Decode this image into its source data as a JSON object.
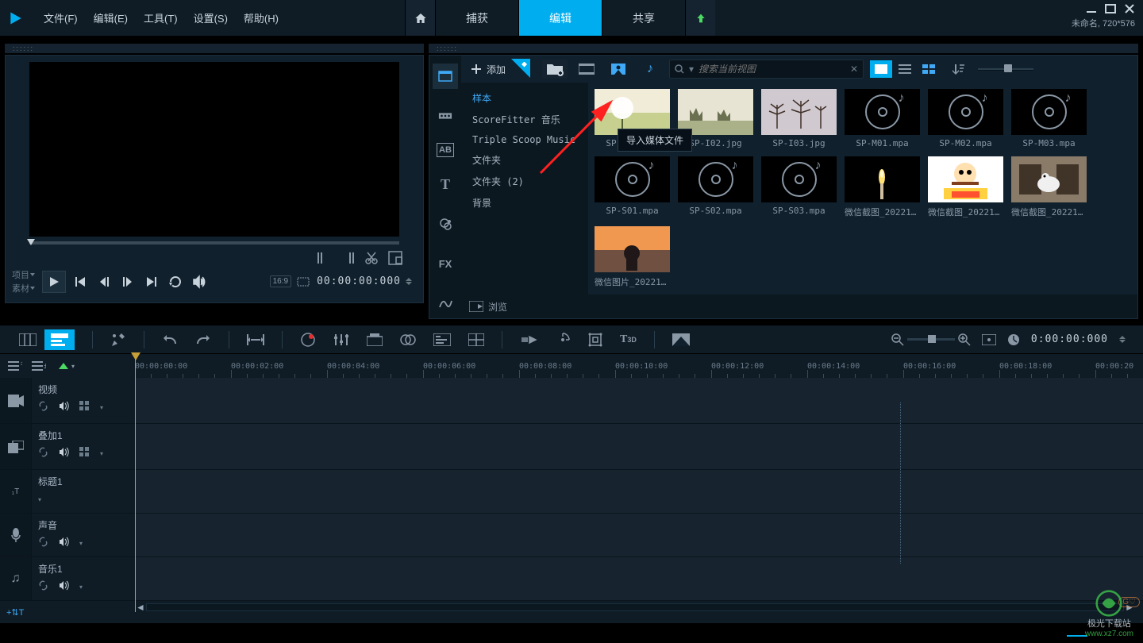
{
  "menus": {
    "file": "文件(F)",
    "edit": "编辑(E)",
    "tools": "工具(T)",
    "settings": "设置(S)",
    "help": "帮助(H)"
  },
  "tabs": {
    "capture": "捕获",
    "edit": "编辑",
    "share": "共享"
  },
  "project_name": "未命名, 720*576",
  "preview": {
    "proj_label": "项目",
    "clip_label": "素材",
    "aspect": "16:9",
    "timecode": "00:00:00:000"
  },
  "library": {
    "add": "添加",
    "tooltip": "导入媒体文件",
    "search_placeholder": "搜索当前视图",
    "browse": "浏览",
    "categories": [
      "样本",
      "ScoreFitter 音乐",
      "Triple Scoop Music",
      "文件夹",
      "文件夹 (2)",
      "背景"
    ],
    "items": [
      {
        "name": "SP-I01.jpg",
        "type": "img",
        "cls": "img1"
      },
      {
        "name": "SP-I02.jpg",
        "type": "img",
        "cls": "img2"
      },
      {
        "name": "SP-I03.jpg",
        "type": "img",
        "cls": "img3"
      },
      {
        "name": "SP-M01.mpa",
        "type": "audio"
      },
      {
        "name": "SP-M02.mpa",
        "type": "audio"
      },
      {
        "name": "SP-M03.mpa",
        "type": "audio"
      },
      {
        "name": "SP-S01.mpa",
        "type": "audio"
      },
      {
        "name": "SP-S02.mpa",
        "type": "audio"
      },
      {
        "name": "SP-S03.mpa",
        "type": "audio"
      },
      {
        "name": "微信截图_202212...",
        "type": "img",
        "cls": "img4"
      },
      {
        "name": "微信截图_202212...",
        "type": "img",
        "cls": "img5"
      },
      {
        "name": "微信截图_202212...",
        "type": "img",
        "cls": "img6"
      },
      {
        "name": "微信图片_202211...",
        "type": "img",
        "cls": "img7"
      }
    ]
  },
  "ruler": [
    "00:00:00:00",
    "00:00:02:00",
    "00:00:04:00",
    "00:00:06:00",
    "00:00:08:00",
    "00:00:10:00",
    "00:00:12:00",
    "00:00:14:00",
    "00:00:16:00",
    "00:00:18:00",
    "00:00:20"
  ],
  "tracks": [
    {
      "name": "视频",
      "icon": "video",
      "big": true,
      "ctrls": 3
    },
    {
      "name": "叠加1",
      "icon": "overlay",
      "big": true,
      "ctrls": 3
    },
    {
      "name": "标题1",
      "icon": "title",
      "big": false,
      "ctrls": 0
    },
    {
      "name": "声音",
      "icon": "voice",
      "big": false,
      "ctrls": 2
    },
    {
      "name": "音乐1",
      "icon": "music",
      "big": false,
      "ctrls": 2
    }
  ],
  "tl_timecode": "0:00:00:000",
  "fx_label": "FX",
  "t_label": "T",
  "t3d_label": "3D",
  "AB": "AB",
  "watermark": "www.xz7.com",
  "watermark_brand": "极光下载站"
}
